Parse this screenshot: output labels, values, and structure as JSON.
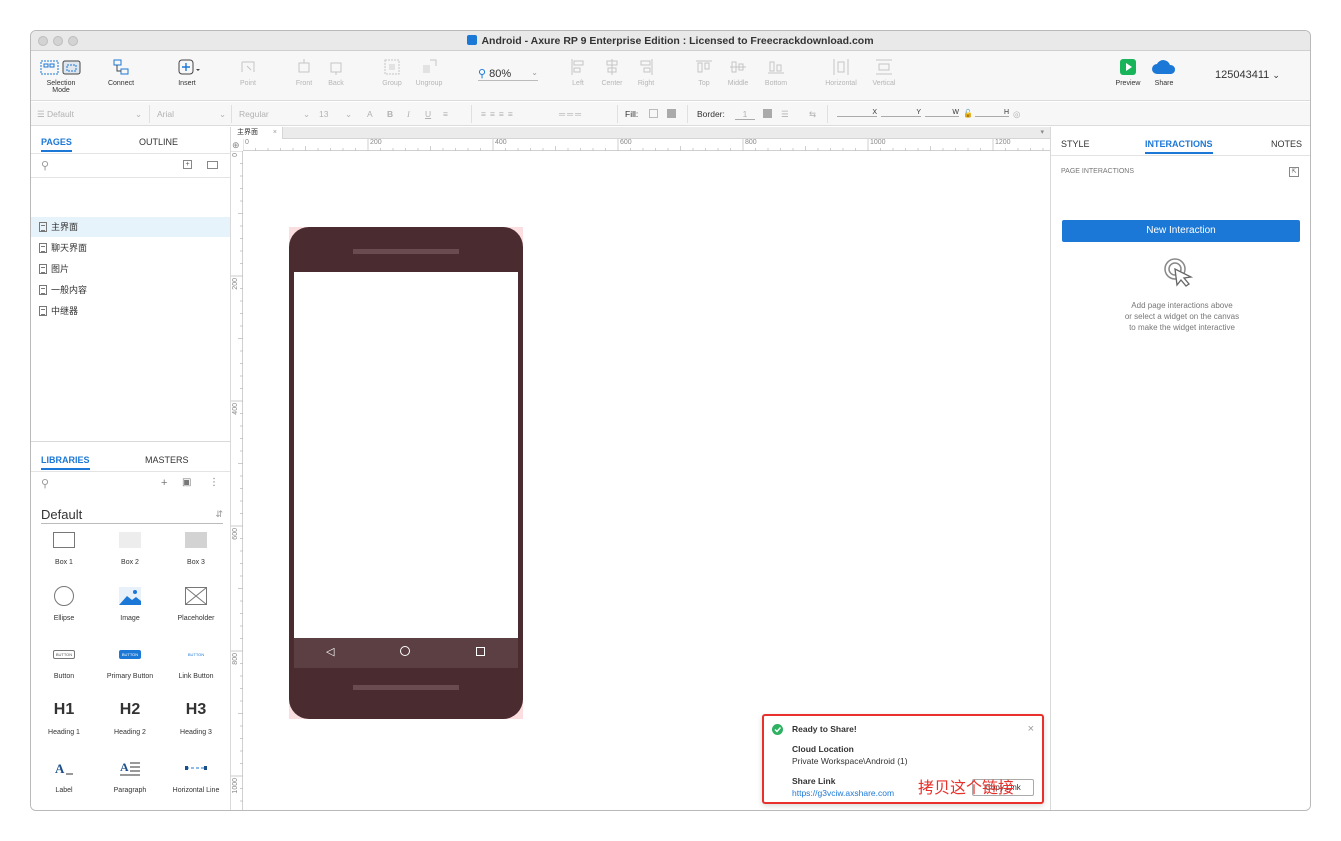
{
  "window": {
    "title": "Android - Axure RP 9 Enterprise Edition : Licensed to Freecrackdownload.com"
  },
  "toolbar": {
    "selection_mode": "Selection Mode",
    "connect": "Connect",
    "insert": "Insert",
    "point": "Point",
    "front": "Front",
    "back": "Back",
    "group": "Group",
    "ungroup": "Ungroup",
    "zoom": "80%",
    "left": "Left",
    "center": "Center",
    "right": "Right",
    "top": "Top",
    "middle": "Middle",
    "bottom": "Bottom",
    "horizontal": "Horizontal",
    "vertical": "Vertical",
    "preview": "Preview",
    "share": "Share",
    "user": "125043411"
  },
  "format": {
    "style": "Default",
    "font": "Arial",
    "weight": "Regular",
    "size": "13",
    "fill_label": "Fill:",
    "border_label": "Border:",
    "border_value": "1",
    "x_label": "X",
    "y_label": "Y",
    "w_label": "W",
    "h_label": "H"
  },
  "pages_panel": {
    "tab_pages": "PAGES",
    "tab_outline": "OUTLINE",
    "pages": [
      "主界面",
      "聊天界面",
      "图片",
      "一般内容",
      "中继器"
    ]
  },
  "libraries_panel": {
    "tab_libraries": "LIBRARIES",
    "tab_masters": "MASTERS",
    "library_name": "Default",
    "widgets": [
      {
        "label": "Box 1",
        "icon": "box1-icon"
      },
      {
        "label": "Box 2",
        "icon": "box2-icon"
      },
      {
        "label": "Box 3",
        "icon": "box3-icon"
      },
      {
        "label": "Ellipse",
        "icon": "ellipse-icon"
      },
      {
        "label": "Image",
        "icon": "image-icon"
      },
      {
        "label": "Placeholder",
        "icon": "placeholder-icon"
      },
      {
        "label": "Button",
        "icon": "button-icon"
      },
      {
        "label": "Primary Button",
        "icon": "primary-button-icon"
      },
      {
        "label": "Link Button",
        "icon": "link-button-icon"
      },
      {
        "label": "Heading 1",
        "icon": "heading1-icon"
      },
      {
        "label": "Heading 2",
        "icon": "heading2-icon"
      },
      {
        "label": "Heading 3",
        "icon": "heading3-icon"
      },
      {
        "label": "Label",
        "icon": "label-icon"
      },
      {
        "label": "Paragraph",
        "icon": "paragraph-icon"
      },
      {
        "label": "Horizontal Line",
        "icon": "horizontal-line-icon"
      }
    ],
    "button_thumb_text": "BUTTON",
    "h1": "H1",
    "h2": "H2",
    "h3": "H3"
  },
  "canvas": {
    "tab_label": "主界面",
    "ruler_h": [
      "0",
      "200",
      "400",
      "600",
      "800",
      "1000",
      "1200"
    ],
    "ruler_v": [
      "0",
      "200",
      "400",
      "600",
      "800",
      "1000"
    ]
  },
  "right_panel": {
    "tab_style": "STYLE",
    "tab_interactions": "INTERACTIONS",
    "tab_notes": "NOTES",
    "section_title": "PAGE INTERACTIONS",
    "new_interaction": "New Interaction",
    "hint_line1": "Add page interactions above",
    "hint_line2": "or select a widget on the canvas",
    "hint_line3": "to make the widget interactive"
  },
  "toast": {
    "title": "Ready to Share!",
    "cloud_label": "Cloud Location",
    "cloud_value": "Private Workspace\\Android (1)",
    "link_label": "Share Link",
    "link_value": "https://g3vciw.axshare.com",
    "copy_button": "Copy Link",
    "annotation": "拷贝这个链接"
  },
  "colors": {
    "accent": "#1c78d6",
    "phone": "#4a2b2f",
    "annotation_red": "#e8312c",
    "success_green": "#2fb162"
  }
}
